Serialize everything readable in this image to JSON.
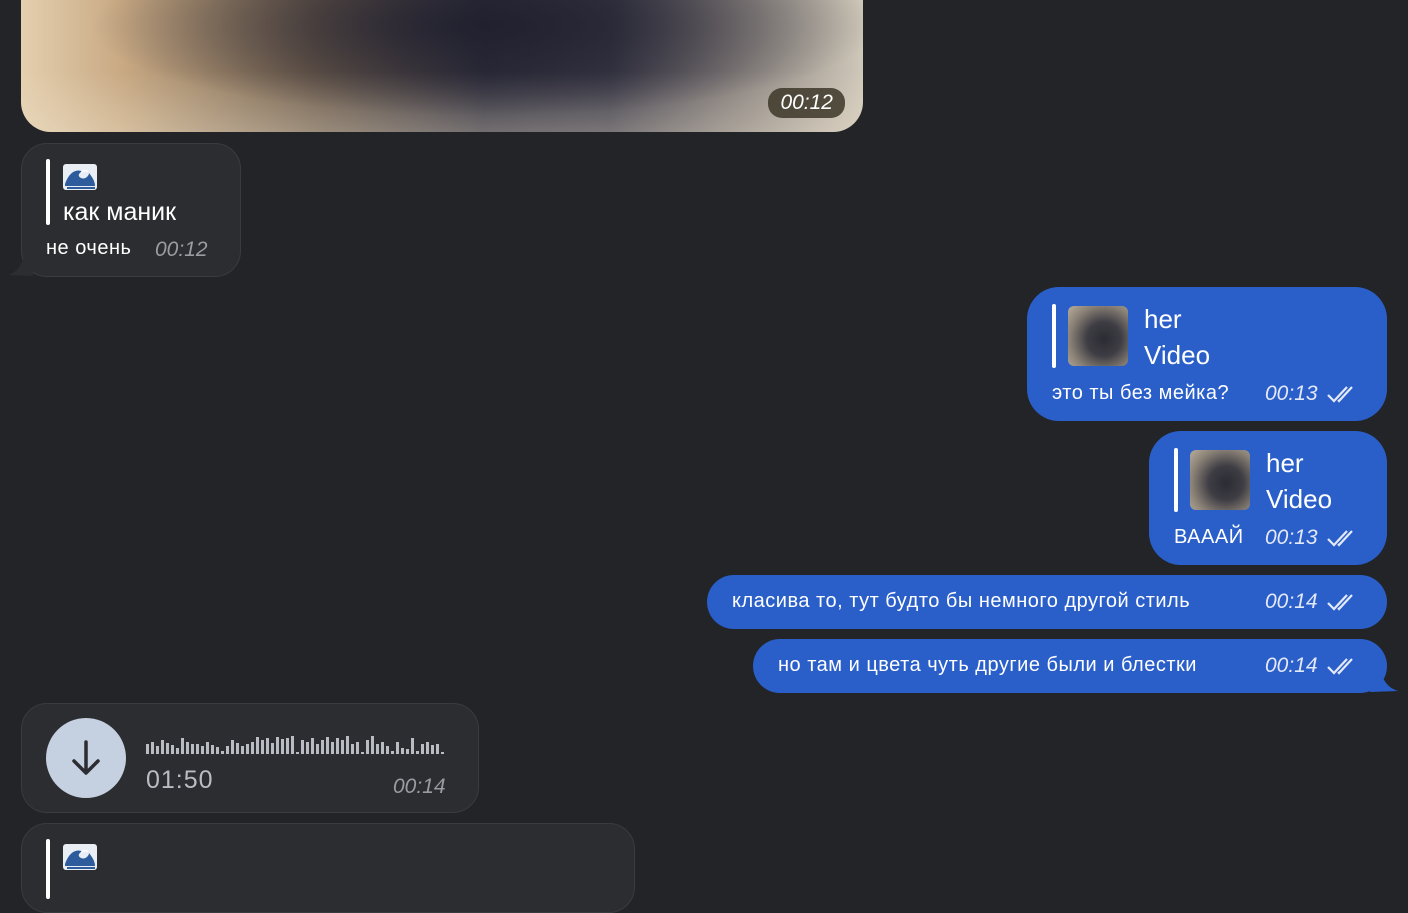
{
  "messages": {
    "video": {
      "time": "00:12"
    },
    "reply_in_1": {
      "quoted": "как маник",
      "text": "не очень",
      "time": "00:12"
    },
    "reply_out_1": {
      "quoted_title": "her",
      "quoted_sub": "Video",
      "text": "это ты без мейка?",
      "time": "00:13"
    },
    "reply_out_2": {
      "quoted_title": "her",
      "quoted_sub": "Video",
      "text": "ВААAЙ",
      "time": "00:13"
    },
    "out_3": {
      "text": "класива то, тут будто бы немного другой стиль",
      "time": "00:14"
    },
    "out_4": {
      "text": "но там и цвета чуть другие были и блестки",
      "time": "00:14"
    },
    "voice": {
      "duration": "01:50",
      "time": "00:14"
    }
  },
  "colors": {
    "background": "#222427",
    "incoming_bubble": "#2c2d30",
    "outgoing_bubble": "#2a5fc9"
  },
  "icons": [
    "wave-emoji-icon",
    "double-check-icon",
    "download-arrow-icon"
  ]
}
